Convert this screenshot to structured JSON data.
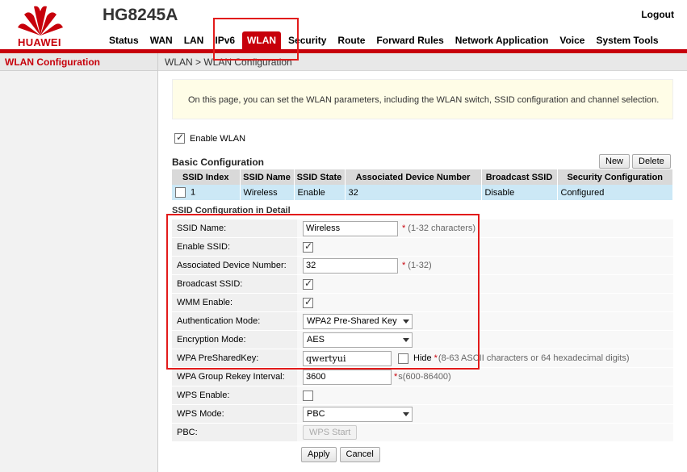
{
  "header": {
    "logo_text": "HUAWEI",
    "model": "HG8245A",
    "logout_label": "Logout",
    "nav": [
      "Status",
      "WAN",
      "LAN",
      "IPv6",
      "WLAN",
      "Security",
      "Route",
      "Forward Rules",
      "Network Application",
      "Voice",
      "System Tools"
    ],
    "active_nav": "WLAN"
  },
  "sidebar": {
    "items": [
      {
        "label": "WLAN Configuration"
      }
    ]
  },
  "breadcrumb": "WLAN > WLAN Configuration",
  "note": "On this page, you can set the WLAN parameters, including the WLAN switch, SSID configuration and channel selection.",
  "enable_wlan": {
    "label": "Enable WLAN",
    "checked": true
  },
  "basic": {
    "title": "Basic Configuration",
    "new_label": "New",
    "delete_label": "Delete",
    "columns": [
      "SSID Index",
      "SSID Name",
      "SSID State",
      "Associated Device Number",
      "Broadcast SSID",
      "Security Configuration"
    ],
    "rows": [
      {
        "index": "1",
        "name": "Wireless",
        "state": "Enable",
        "devices": "32",
        "broadcast": "Disable",
        "security": "Configured"
      }
    ]
  },
  "detail": {
    "title": "SSID Configuration in Detail",
    "ssid_name": {
      "label": "SSID Name:",
      "value": "Wireless",
      "hint": "(1-32 characters)"
    },
    "enable_ssid": {
      "label": "Enable SSID:",
      "checked": true
    },
    "assoc_devices": {
      "label": "Associated Device Number:",
      "value": "32",
      "hint": "(1-32)"
    },
    "broadcast_ssid": {
      "label": "Broadcast SSID:",
      "checked": true
    },
    "wmm": {
      "label": "WMM Enable:",
      "checked": true
    },
    "auth_mode": {
      "label": "Authentication Mode:",
      "value": "WPA2 Pre-Shared Key"
    },
    "encryption": {
      "label": "Encryption Mode:",
      "value": "AES"
    },
    "psk": {
      "label": "WPA PreSharedKey:",
      "value": "qwertyui",
      "hide_label": "Hide",
      "hint": "(8-63 ASCII characters or 64 hexadecimal digits)"
    },
    "rekey": {
      "label": "WPA Group Rekey Interval:",
      "value": "3600",
      "hint": "s(600-86400)"
    },
    "wps_enable": {
      "label": "WPS Enable:",
      "checked": false
    },
    "wps_mode": {
      "label": "WPS Mode:",
      "value": "PBC"
    },
    "pbc": {
      "label": "PBC:",
      "button": "WPS Start"
    }
  },
  "actions": {
    "apply": "Apply",
    "cancel": "Cancel"
  },
  "colors": {
    "brand": "#c7000b",
    "annotation": "#e21b1b",
    "row_highlight": "#cce8f6",
    "note_bg": "#fffde7"
  }
}
